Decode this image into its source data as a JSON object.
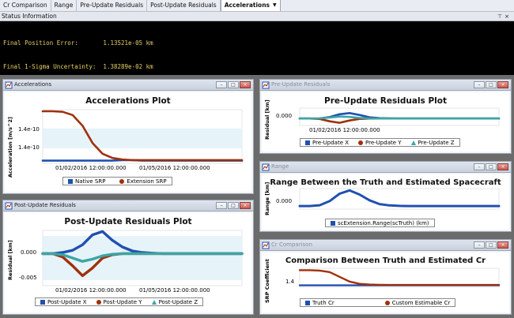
{
  "tabs": [
    "Cr Comparison",
    "Range",
    "Pre-Update Residuals",
    "Post-Update Residuals",
    "Accelerations"
  ],
  "active_tab_label": "Accelerations",
  "status": {
    "title": "Status Information",
    "lines": [
      "Final Position Error:       1.13521e-05 km",
      "Final 1-Sigma Uncertainty:  1.38289e-02 km"
    ]
  },
  "windows": {
    "accelerations": {
      "title": "Accelerations"
    },
    "pre": {
      "title": "Pre-Update Residuals"
    },
    "post": {
      "title": "Post-Update Residuals"
    },
    "range": {
      "title": "Range"
    },
    "cr": {
      "title": "Cr Comparison"
    }
  },
  "colors": {
    "blue": "#2050b0",
    "red": "#a0300c",
    "teal": "#3aa6a6",
    "band": "#e6f3f8"
  },
  "chart_data": [
    {
      "id": "accelerations",
      "type": "line",
      "title": "Accelerations Plot",
      "ylabel": "Acceleration [m/s^2]",
      "yticks": [
        "1.4e-10",
        "1.4e-10"
      ],
      "xticks": [
        "01/02/2016 12:00:00.000",
        "01/05/2016 12:00:00.000"
      ],
      "legend": [
        "Native SRP",
        "Extension SRP"
      ],
      "series": [
        {
          "name": "Native SRP",
          "values": [
            0.05,
            0.05,
            0.05,
            0.05,
            0.05,
            0.05,
            0.05,
            0.05,
            0.06,
            0.06,
            0.05,
            0.05,
            0.05,
            0.05,
            0.05,
            0.05,
            0.05,
            0.05,
            0.05,
            0.05,
            0.05
          ]
        },
        {
          "name": "Extension SRP",
          "values": [
            0.97,
            0.97,
            0.96,
            0.9,
            0.7,
            0.38,
            0.18,
            0.1,
            0.07,
            0.06,
            0.06,
            0.06,
            0.06,
            0.06,
            0.06,
            0.06,
            0.06,
            0.06,
            0.06,
            0.06,
            0.06
          ]
        }
      ]
    },
    {
      "id": "pre",
      "type": "line",
      "title": "Pre-Update Residuals Plot",
      "ylabel": "Residual [km]",
      "yticks": [
        "0.000"
      ],
      "xticks": [
        "01/02/2016 12:00:00.000"
      ],
      "legend": [
        "Pre-Update X",
        "Pre-Update Y",
        "Pre-Update Z"
      ],
      "series": [
        {
          "name": "Pre-Update X",
          "values": [
            0,
            0,
            0.02,
            0.18,
            0.55,
            0.7,
            0.45,
            0.15,
            0.05,
            0.02,
            0,
            0,
            0,
            0,
            0,
            0,
            0,
            0,
            0,
            0,
            0
          ]
        },
        {
          "name": "Pre-Update Y",
          "values": [
            0,
            0,
            -0.05,
            -0.35,
            -0.55,
            -0.25,
            -0.05,
            0,
            0,
            0,
            0,
            0,
            0,
            0,
            0,
            0,
            0,
            0,
            0,
            0,
            0
          ]
        },
        {
          "name": "Pre-Update Z",
          "values": [
            0,
            0,
            0.02,
            0.12,
            0.25,
            0.2,
            0.08,
            0.02,
            0,
            0,
            0,
            0,
            0,
            0,
            0,
            0,
            0,
            0,
            0,
            0,
            0
          ]
        }
      ]
    },
    {
      "id": "range",
      "type": "line",
      "title": "Range Between the Truth and Estimated Spacecraft",
      "ylabel": "Range [km]",
      "yticks": [
        "0.000"
      ],
      "xticks": [],
      "legend": [
        "scExtension.Range(scTruth) (km)"
      ],
      "series": [
        {
          "name": "scExtension.Range(scTruth) (km)",
          "values": [
            0,
            0,
            0.05,
            0.3,
            0.75,
            0.95,
            0.7,
            0.35,
            0.12,
            0.04,
            0.01,
            0,
            0,
            0,
            0,
            0,
            0,
            0,
            0,
            0,
            0
          ]
        }
      ]
    },
    {
      "id": "post",
      "type": "line",
      "title": "Post-Update Residuals Plot",
      "ylabel": "Residual [km]",
      "yticks": [
        "0.000",
        "-0.005"
      ],
      "xticks": [
        "01/02/2016 12:00:00.000",
        "01/05/2016 12:00:00.000"
      ],
      "legend": [
        "Post-Update X",
        "Post-Update Y",
        "Post-Update Z"
      ],
      "series": [
        {
          "name": "Post-Update X",
          "values": [
            0,
            0,
            0.05,
            0.15,
            0.4,
            0.85,
            1.0,
            0.6,
            0.3,
            0.12,
            0.05,
            0.02,
            0,
            0,
            0,
            0,
            0,
            0,
            0,
            0,
            0
          ]
        },
        {
          "name": "Post-Update Y",
          "values": [
            0,
            0,
            -0.15,
            -0.55,
            -1.0,
            -0.65,
            -0.2,
            -0.05,
            0,
            0,
            0,
            0,
            0,
            0,
            0,
            0,
            0,
            0,
            0,
            0,
            0
          ]
        },
        {
          "name": "Post-Update Z",
          "values": [
            0,
            0,
            -0.05,
            -0.2,
            -0.35,
            -0.25,
            -0.1,
            -0.03,
            0,
            0,
            0,
            0,
            0,
            0,
            0,
            0,
            0,
            0,
            0,
            0,
            0
          ]
        }
      ]
    },
    {
      "id": "cr",
      "type": "line",
      "title": "Comparison Between Truth and Estimated Cr",
      "ylabel": "SRP Coefficient",
      "yticks": [
        "1.4"
      ],
      "xticks": [],
      "legend": [
        "Truth Cr",
        "Custom Estimable Cr"
      ],
      "series": [
        {
          "name": "Truth Cr",
          "values": [
            0.1,
            0.1,
            0.1,
            0.1,
            0.1,
            0.1,
            0.1,
            0.1,
            0.1,
            0.1,
            0.1,
            0.1,
            0.1,
            0.1,
            0.1,
            0.1,
            0.1,
            0.1,
            0.1,
            0.1,
            0.1
          ]
        },
        {
          "name": "Custom Estimable Cr",
          "values": [
            0.9,
            0.9,
            0.88,
            0.8,
            0.55,
            0.3,
            0.18,
            0.14,
            0.13,
            0.12,
            0.12,
            0.12,
            0.12,
            0.12,
            0.12,
            0.12,
            0.12,
            0.12,
            0.12,
            0.12,
            0.12
          ]
        }
      ]
    }
  ]
}
